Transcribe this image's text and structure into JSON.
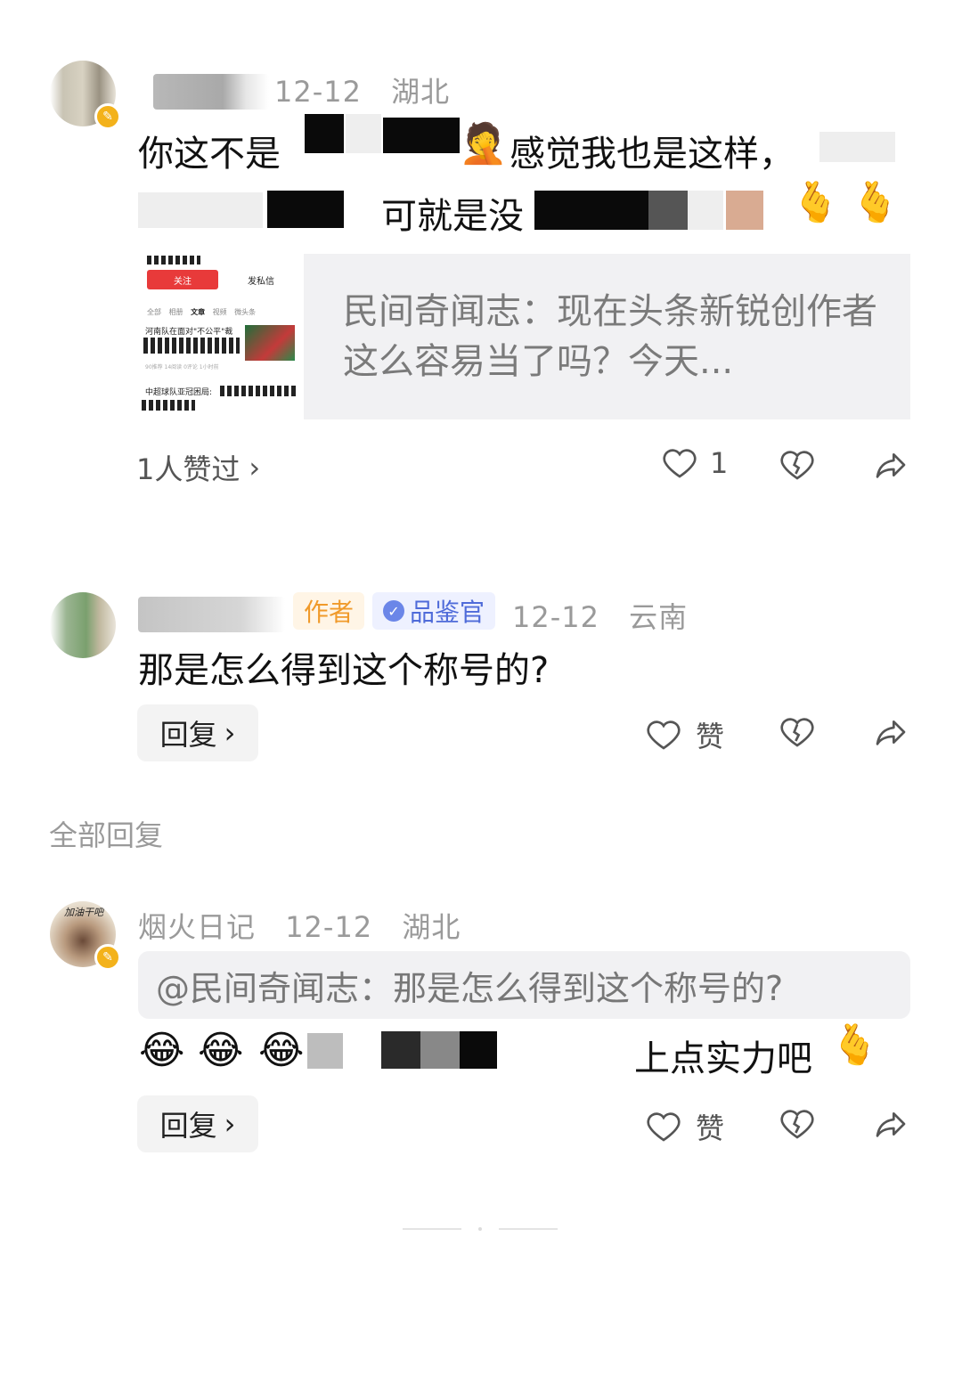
{
  "comment1": {
    "meta_date": "12-12",
    "meta_region": "湖北",
    "line1_a": "你这不是",
    "line1_b": "感觉我也是这样，",
    "line2_a": "可就是没",
    "quote_card_text": "民间奇闻志：现在头条新锐创作者这么容易当了吗？今天...",
    "thumb": {
      "follow_label": "关注",
      "message_label": "发私信",
      "tabs": [
        "全部",
        "相册",
        "文章",
        "视频",
        "微头条"
      ],
      "item1": "河南队在面对\"不公平\"裁",
      "item1_stats": "90推荐 14阅读 0评论 1小时前",
      "item2": "中超球队亚冠困局:"
    },
    "likes_label": "1人赞过",
    "like_count": "1"
  },
  "comment2": {
    "tag_author": "作者",
    "tag_judge": "品鉴官",
    "meta_date": "12-12",
    "meta_region": "云南",
    "text": "那是怎么得到这个称号的?",
    "reply_label": "回复",
    "like_label": "赞"
  },
  "section_label": "全部回复",
  "comment3": {
    "username": "烟火日记",
    "meta_date": "12-12",
    "meta_region": "湖北",
    "avatar_text": "加油干吧",
    "quote": "@民间奇闻志：那是怎么得到这个称号的?",
    "text_tail": "上点实力吧",
    "reply_label": "回复",
    "like_label": "赞"
  },
  "colors": {
    "badge": "#f3b21b",
    "author_tag": "#f09a2a",
    "judge_tag": "#4f6bd9",
    "follow_btn": "#e83a3a"
  }
}
